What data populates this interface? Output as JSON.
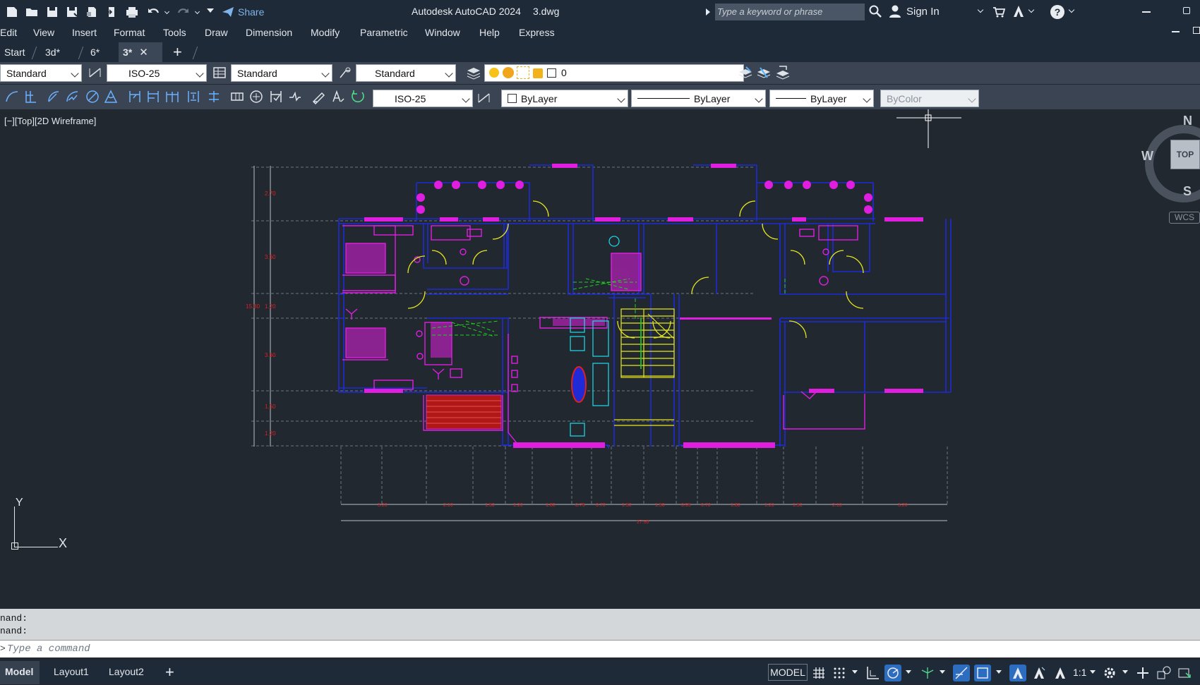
{
  "title_bar": {
    "app_title": "Autodesk AutoCAD 2024",
    "file_name": "3.dwg",
    "share_label": "Share",
    "search_placeholder": "Type a keyword or phrase",
    "sign_in_label": "Sign In"
  },
  "menu": [
    "Edit",
    "View",
    "Insert",
    "Format",
    "Tools",
    "Draw",
    "Dimension",
    "Modify",
    "Parametric",
    "Window",
    "Help",
    "Express"
  ],
  "tabs": [
    {
      "label": "Start"
    },
    {
      "label": "3d*"
    },
    {
      "label": "6*"
    },
    {
      "label": "3*",
      "active": true
    }
  ],
  "toolbar1": {
    "text_style": "Standard",
    "dim_style": "ISO-25",
    "table_style": "Standard",
    "multileader_style": "Standard",
    "layer": "0"
  },
  "toolbar2": {
    "dim_style": "ISO-25",
    "color": "ByLayer",
    "linetype": "ByLayer",
    "lineweight": "ByLayer",
    "plot_style": "ByColor"
  },
  "viewport": {
    "label": "[−][Top][2D Wireframe]",
    "viewcube": {
      "top": "TOP",
      "north": "N",
      "south": "S",
      "west": "W",
      "wcs": "WCS"
    },
    "ucs": {
      "x": "X",
      "y": "Y"
    }
  },
  "drawing": {
    "vertical_dims": [
      "2.70",
      "3.60",
      "1.20",
      "3.60",
      "1.50",
      "1.20"
    ],
    "vertical_total": "15.80",
    "horizontal_dims": [
      "3.20",
      "2.10",
      "1.50",
      "1.20",
      "1.80",
      "0.75",
      "0.70",
      "1.50",
      "1.50",
      "0.95",
      "0.70",
      "1.80",
      "1.20",
      "1.50",
      "2.10",
      "3.20"
    ],
    "horizontal_total": "27.60"
  },
  "command": {
    "history": [
      "nand:",
      "nand:"
    ],
    "placeholder": "Type a command"
  },
  "layouts": [
    "Model",
    "Layout1",
    "Layout2"
  ],
  "status": {
    "model_label": "MODEL",
    "scale": "1:1"
  },
  "colors": {
    "background": "#212830",
    "chrome": "#1f2a38",
    "toolbar": "#3b4453",
    "wall": "#1e2bd6",
    "furniture": "#e01ee0",
    "dimension": "#e02020",
    "stair": "#e6e61e",
    "hatch_green": "#1ed21e",
    "cyan": "#20d0e0"
  }
}
